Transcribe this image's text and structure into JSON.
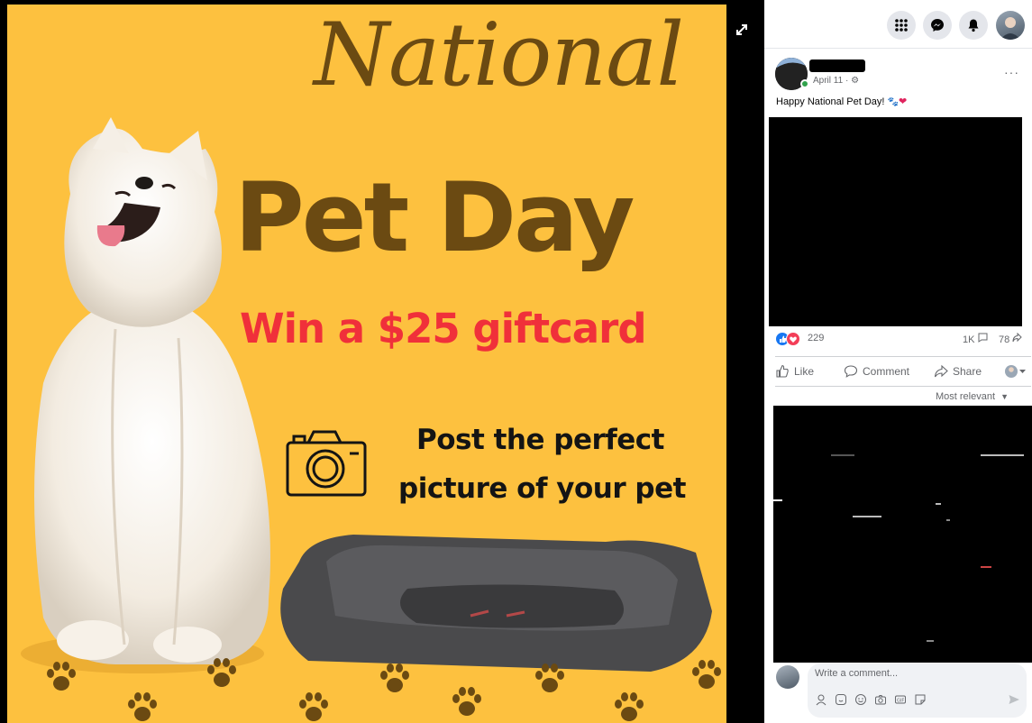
{
  "poster": {
    "title_script": "National",
    "title_bold": "Pet Day",
    "prize": "Win a $25 giftcard",
    "instruction_line1": "Post the perfect",
    "instruction_line2": "picture of your pet"
  },
  "post": {
    "date": "April 11 · ",
    "text": "Happy National Pet Day! ",
    "reaction_count": "229",
    "comment_count": "1K",
    "share_count": "78",
    "more_label": "···"
  },
  "actions": {
    "like": "Like",
    "comment": "Comment",
    "share": "Share"
  },
  "comments": {
    "sort_label": "Most relevant",
    "composer_placeholder": "Write a comment..."
  },
  "colors": {
    "poster_bg": "#fdc13f",
    "title_brown": "#6b4a12",
    "prize_red": "#f0303a",
    "fb_blue": "#1877f2",
    "love_red": "#f33e58"
  },
  "icons": {
    "expand": "expand-icon",
    "menu": "grid-menu-icon",
    "messenger": "messenger-icon",
    "notifications": "bell-icon",
    "camera": "camera-icon"
  }
}
